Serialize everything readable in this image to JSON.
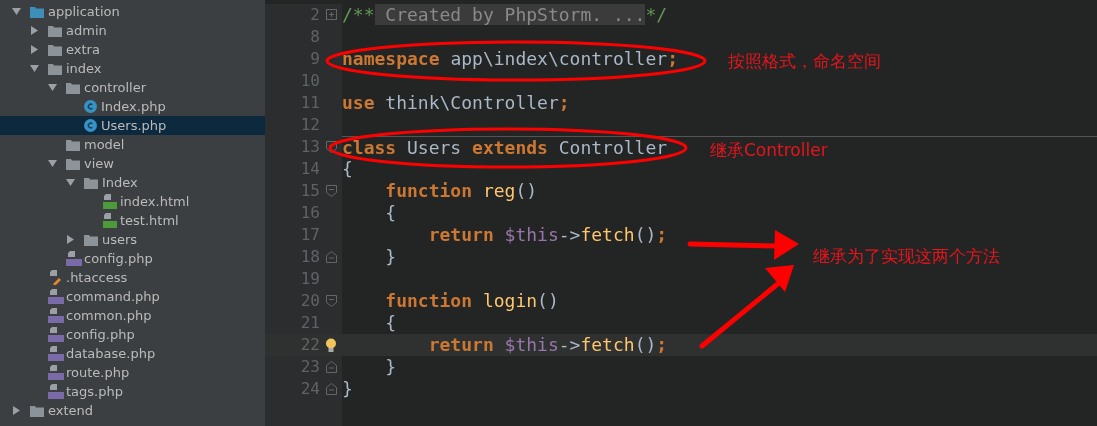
{
  "project_tree": [
    {
      "label": "application",
      "kind": "source-folder",
      "expanded": true,
      "selected": false,
      "children": [
        {
          "label": "admin",
          "kind": "folder",
          "expanded": false,
          "selected": false
        },
        {
          "label": "extra",
          "kind": "folder",
          "expanded": false,
          "selected": false
        },
        {
          "label": "index",
          "kind": "folder",
          "expanded": true,
          "selected": false,
          "children": [
            {
              "label": "controller",
              "kind": "folder",
              "expanded": true,
              "selected": false,
              "children": [
                {
                  "label": "Index.php",
                  "kind": "class",
                  "selected": false
                },
                {
                  "label": "Users.php",
                  "kind": "class",
                  "selected": true
                }
              ]
            },
            {
              "label": "model",
              "kind": "folder",
              "selected": false
            },
            {
              "label": "view",
              "kind": "folder",
              "expanded": true,
              "selected": false,
              "children": [
                {
                  "label": "Index",
                  "kind": "folder",
                  "expanded": true,
                  "selected": false,
                  "children": [
                    {
                      "label": "index.html",
                      "kind": "html",
                      "selected": false
                    },
                    {
                      "label": "test.html",
                      "kind": "html",
                      "selected": false
                    }
                  ]
                },
                {
                  "label": "users",
                  "kind": "folder",
                  "expanded": false,
                  "selected": false
                }
              ]
            },
            {
              "label": "config.php",
              "kind": "php",
              "selected": false
            }
          ]
        },
        {
          "label": ".htaccess",
          "kind": "htaccess",
          "selected": false
        },
        {
          "label": "command.php",
          "kind": "php",
          "selected": false
        },
        {
          "label": "common.php",
          "kind": "php",
          "selected": false
        },
        {
          "label": "config.php",
          "kind": "php",
          "selected": false
        },
        {
          "label": "database.php",
          "kind": "php",
          "selected": false
        },
        {
          "label": "route.php",
          "kind": "php",
          "selected": false
        },
        {
          "label": "tags.php",
          "kind": "php",
          "selected": false
        }
      ]
    },
    {
      "label": "extend",
      "kind": "folder",
      "expanded": false,
      "selected": false
    }
  ],
  "editor": {
    "lines": [
      {
        "number": "2",
        "kind": "collapsed",
        "current": false,
        "tokens": [
          {
            "text": "/**",
            "kind": "comment"
          },
          {
            "text": " Created by PhpStorm. ...",
            "kind": "folded"
          },
          {
            "text": "*/",
            "kind": "comment"
          }
        ]
      },
      {
        "number": "8",
        "kind": "plain",
        "current": false
      },
      {
        "number": "9",
        "kind": "plain",
        "current": false,
        "tokens": [
          {
            "text": "namespace",
            "kind": "keyword"
          },
          {
            "text": " app\\index\\controller",
            "kind": "plain"
          },
          {
            "text": ";",
            "kind": "keyword"
          }
        ]
      },
      {
        "number": "10",
        "kind": "plain",
        "current": false
      },
      {
        "number": "11",
        "kind": "plain",
        "current": false,
        "tokens": [
          {
            "text": "use",
            "kind": "keyword"
          },
          {
            "text": " think\\Controller",
            "kind": "plain"
          },
          {
            "text": ";",
            "kind": "keyword"
          }
        ]
      },
      {
        "number": "12",
        "kind": "plain",
        "current": false
      },
      {
        "number": "13",
        "kind": "opener",
        "current": false,
        "tokens": [
          {
            "text": "class",
            "kind": "keyword"
          },
          {
            "text": " Users ",
            "kind": "plain"
          },
          {
            "text": "extends",
            "kind": "keyword"
          },
          {
            "text": " Controller",
            "kind": "plain"
          }
        ]
      },
      {
        "number": "14",
        "kind": "plain",
        "current": false,
        "tokens": [
          {
            "text": "{",
            "kind": "plain"
          }
        ]
      },
      {
        "number": "15",
        "kind": "opener",
        "current": false,
        "tokens": [
          {
            "text": "    function",
            "kind": "keyword"
          },
          {
            "text": " reg",
            "kind": "function"
          },
          {
            "text": "()",
            "kind": "plain"
          }
        ]
      },
      {
        "number": "16",
        "kind": "plain",
        "current": false,
        "tokens": [
          {
            "text": "    {",
            "kind": "plain"
          }
        ]
      },
      {
        "number": "17",
        "kind": "plain",
        "current": false,
        "tokens": [
          {
            "text": "        return",
            "kind": "keyword"
          },
          {
            "text": " $this",
            "kind": "variable"
          },
          {
            "text": "->",
            "kind": "plain"
          },
          {
            "text": "fetch",
            "kind": "function"
          },
          {
            "text": "()",
            "kind": "plain"
          },
          {
            "text": ";",
            "kind": "keyword"
          }
        ]
      },
      {
        "number": "18",
        "kind": "closer",
        "current": false,
        "tokens": [
          {
            "text": "    }",
            "kind": "plain"
          }
        ]
      },
      {
        "number": "19",
        "kind": "plain",
        "current": false
      },
      {
        "number": "20",
        "kind": "opener",
        "current": false,
        "tokens": [
          {
            "text": "    function",
            "kind": "keyword"
          },
          {
            "text": " login",
            "kind": "function"
          },
          {
            "text": "()",
            "kind": "plain"
          }
        ]
      },
      {
        "number": "21",
        "kind": "plain",
        "current": false,
        "tokens": [
          {
            "text": "    {",
            "kind": "plain"
          }
        ]
      },
      {
        "number": "22",
        "kind": "plain",
        "current": true,
        "tokens": [
          {
            "text": "        return",
            "kind": "keyword"
          },
          {
            "text": " $this",
            "kind": "variable"
          },
          {
            "text": "->",
            "kind": "plain"
          },
          {
            "text": "fetch",
            "kind": "function"
          },
          {
            "text": "()",
            "kind": "plain"
          },
          {
            "text": ";",
            "kind": "keyword"
          }
        ]
      },
      {
        "number": "23",
        "kind": "closer",
        "current": false,
        "tokens": [
          {
            "text": "    }",
            "kind": "plain"
          }
        ]
      },
      {
        "number": "24",
        "kind": "closer",
        "current": false,
        "tokens": [
          {
            "text": "}",
            "kind": "plain"
          }
        ]
      }
    ]
  },
  "annotations": [
    "按照格式，命名空间",
    "继承Controller",
    "继承为了实现这两个方法"
  ]
}
